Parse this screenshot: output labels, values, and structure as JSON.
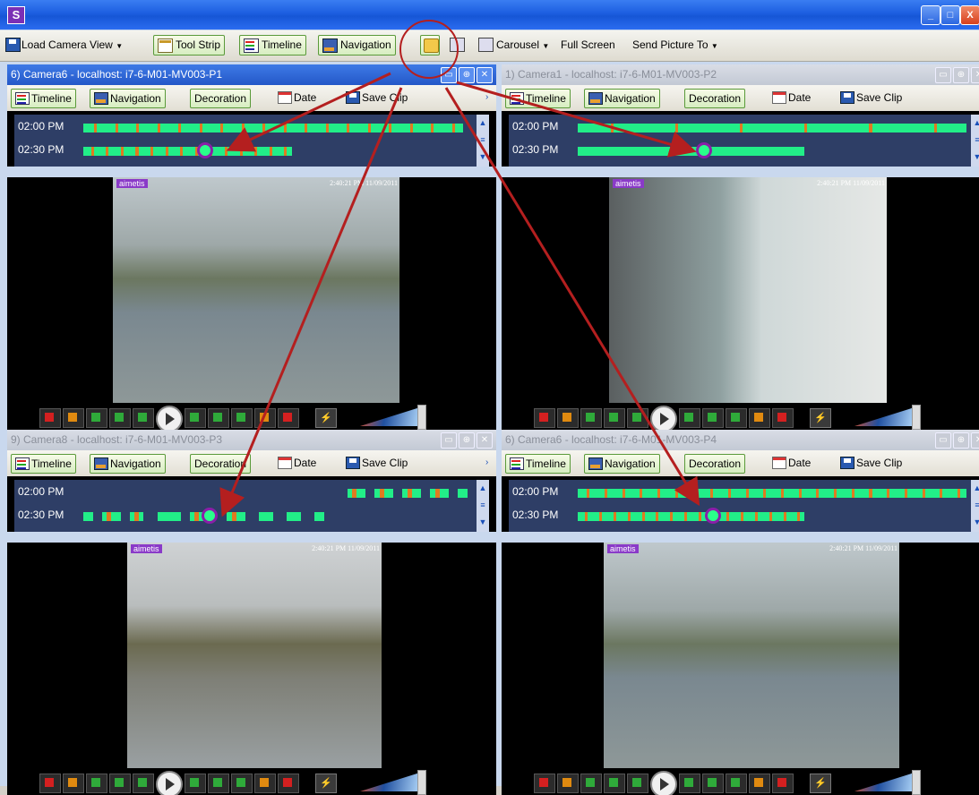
{
  "window": {
    "logo": "S",
    "min": "_",
    "max": "□",
    "close": "X"
  },
  "toolbar": {
    "load_camera_view": "Load Camera View",
    "tool_strip": "Tool Strip",
    "timeline": "Timeline",
    "navigation": "Navigation",
    "carousel": "Carousel",
    "full_screen": "Full Screen",
    "send_picture_to": "Send Picture To"
  },
  "pane_buttons": {
    "timeline": "Timeline",
    "navigation": "Navigation",
    "decoration": "Decoration",
    "date": "Date",
    "save_clip": "Save Clip"
  },
  "timeline_labels": {
    "row1": "02:00 PM",
    "row2": "02:30 PM"
  },
  "osd": {
    "brand": "aimetis",
    "timestamp": "2:40:21 PM 11/09/2011"
  },
  "panes": [
    {
      "title": "6) Camera6 - localhost: i7-6-M01-MV003-P1",
      "active": true
    },
    {
      "title": "1) Camera1 - localhost: i7-6-M01-MV003-P2",
      "active": false
    },
    {
      "title": "9) Camera8 - localhost: i7-6-M01-MV003-P3",
      "active": false
    },
    {
      "title": "6) Camera6 - localhost: i7-6-M01-MV003-P4",
      "active": false
    }
  ],
  "colors": {
    "accent": "#2458c8",
    "timeline_bg": "#2e3e66",
    "recording": "#22ee88",
    "motion": "#e07a20",
    "annotation": "#b41f1f"
  }
}
